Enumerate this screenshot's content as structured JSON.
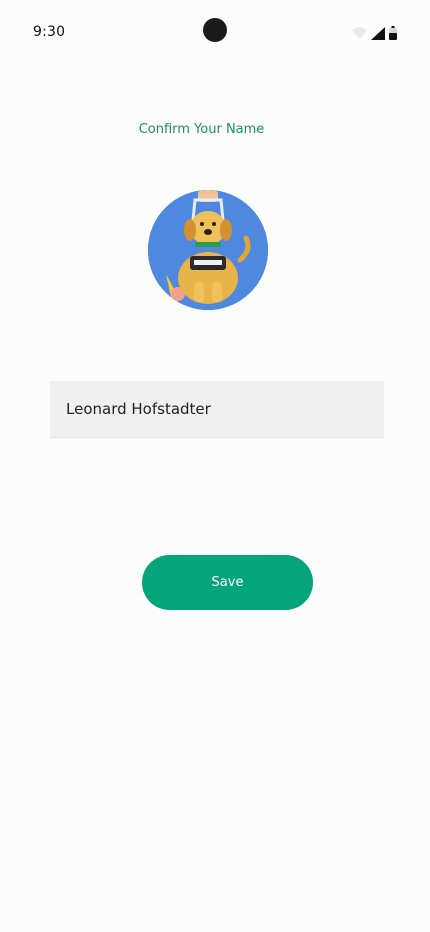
{
  "status_bar": {
    "time": "9:30",
    "icons": [
      "wifi-icon",
      "cellular-signal-icon",
      "battery-icon"
    ]
  },
  "title": "Confirm Your Name",
  "avatar": {
    "icon": "dog-avatar-icon"
  },
  "name_field": {
    "value": "Leonard Hofstadter"
  },
  "save_button": {
    "label": "Save"
  },
  "colors": {
    "accent": "#04a57a",
    "title": "#1b8f6b",
    "field_background": "#f0f0f0",
    "avatar_background": "#4e88df"
  }
}
